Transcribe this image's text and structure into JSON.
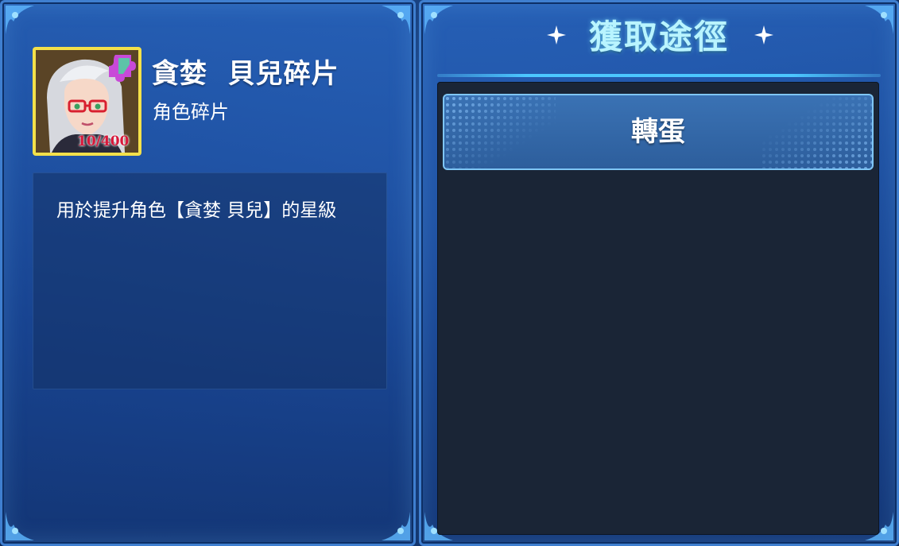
{
  "item": {
    "name": "貪婪  貝兒碎片",
    "type": "角色碎片",
    "shard_count": "10/400",
    "description": "用於提升角色【貪婪  貝兒】的星級"
  },
  "sources": {
    "title": "獲取途徑",
    "items": [
      {
        "label": "轉蛋"
      }
    ]
  },
  "colors": {
    "title_cyan": "#b9f4ff",
    "frame_gold": "#f3e04a",
    "panel_blue": "#2a64b4",
    "list_bg": "#1a2536",
    "shard_red": "#d8183a"
  }
}
